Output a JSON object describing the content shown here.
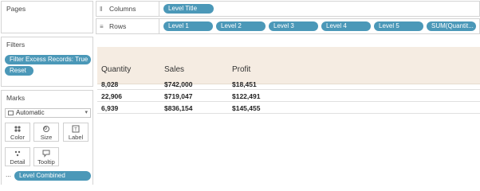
{
  "pages": {
    "title": "Pages"
  },
  "filters": {
    "title": "Filters",
    "items": [
      "Filter Excess Records: True",
      "Reset"
    ]
  },
  "marks": {
    "title": "Marks",
    "mark_type": "Automatic",
    "buttons": [
      "Color",
      "Size",
      "Label",
      "Detail",
      "Tooltip"
    ],
    "field": "Level Combined"
  },
  "columns_shelf": {
    "label": "Columns",
    "icon": "columns-icon",
    "pills": [
      "Level Title"
    ]
  },
  "rows_shelf": {
    "label": "Rows",
    "icon": "rows-icon",
    "pills": [
      "Level 1",
      "Level 2",
      "Level 3",
      "Level 4",
      "Level 5",
      "SUM(Quantit..."
    ]
  },
  "table": {
    "headers": [
      "Quantity",
      "Sales",
      "Profit"
    ],
    "rows": [
      [
        "8,028",
        "$742,000",
        "$18,451"
      ],
      [
        "22,906",
        "$719,047",
        "$122,491"
      ],
      [
        "6,939",
        "$836,154",
        "$145,455"
      ]
    ]
  },
  "colors": {
    "pill": "#4b98b8",
    "header_band": "#f5ece2",
    "panel_border": "#d4d4d4"
  }
}
